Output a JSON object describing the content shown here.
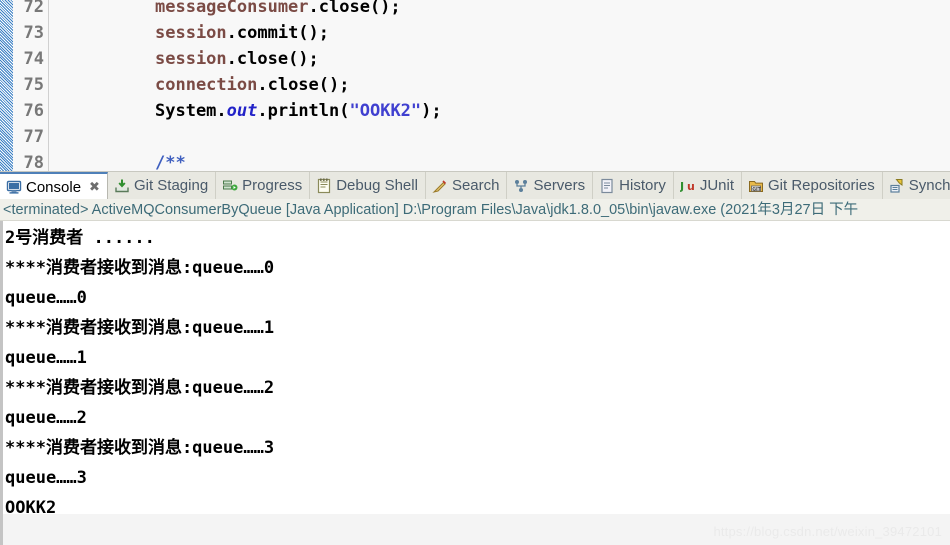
{
  "editor": {
    "lines": [
      {
        "num": "72",
        "segments": [
          {
            "text": "messageConsumer",
            "style": "var"
          },
          {
            "text": ".close();",
            "style": "plain"
          }
        ]
      },
      {
        "num": "73",
        "segments": [
          {
            "text": "session",
            "style": "var"
          },
          {
            "text": ".commit();",
            "style": "plain"
          }
        ]
      },
      {
        "num": "74",
        "segments": [
          {
            "text": "session",
            "style": "var"
          },
          {
            "text": ".close();",
            "style": "plain"
          }
        ]
      },
      {
        "num": "75",
        "segments": [
          {
            "text": "connection",
            "style": "var"
          },
          {
            "text": ".close();",
            "style": "plain"
          }
        ]
      },
      {
        "num": "76",
        "segments": [
          {
            "text": "System.",
            "style": "plain"
          },
          {
            "text": "out",
            "style": "field"
          },
          {
            "text": ".println(",
            "style": "plain"
          },
          {
            "text": "\"OOKK2\"",
            "style": "str"
          },
          {
            "text": ");",
            "style": "plain"
          }
        ]
      },
      {
        "num": "77",
        "segments": []
      },
      {
        "num": "78",
        "segments": [
          {
            "text": "/**",
            "style": "cmt"
          }
        ]
      }
    ]
  },
  "tabs": [
    {
      "label": "Console",
      "icon": "console-icon",
      "active": true,
      "close": "✖"
    },
    {
      "label": "Git Staging",
      "icon": "git-staging-icon",
      "active": false,
      "close": ""
    },
    {
      "label": "Progress",
      "icon": "progress-icon",
      "active": false,
      "close": ""
    },
    {
      "label": "Debug Shell",
      "icon": "debug-shell-icon",
      "active": false,
      "close": ""
    },
    {
      "label": "Search",
      "icon": "search-icon",
      "active": false,
      "close": ""
    },
    {
      "label": "Servers",
      "icon": "servers-icon",
      "active": false,
      "close": ""
    },
    {
      "label": "History",
      "icon": "history-icon",
      "active": false,
      "close": ""
    },
    {
      "label": "JUnit",
      "icon": "junit-icon",
      "active": false,
      "close": ""
    },
    {
      "label": "Git Repositories",
      "icon": "git-repositories-icon",
      "active": false,
      "close": ""
    },
    {
      "label": "Synchro",
      "icon": "synchronize-icon",
      "active": false,
      "close": ""
    }
  ],
  "launch": {
    "text": "<terminated> ActiveMQConsumerByQueue [Java Application] D:\\Program Files\\Java\\jdk1.8.0_05\\bin\\javaw.exe  (2021年3月27日 下午"
  },
  "console": {
    "output": [
      "2号消费者 ......",
      "****消费者接收到消息:queue……0",
      "queue……0",
      "****消费者接收到消息:queue……1",
      "queue……1",
      "****消费者接收到消息:queue……2",
      "queue……2",
      "****消费者接收到消息:queue……3",
      "queue……3",
      "OOKK2"
    ]
  },
  "watermark": {
    "text": "https://blog.csdn.net/weixin_39472101"
  },
  "colors": {
    "variable": "#7b4b45",
    "field": "#2323c8",
    "string": "#4040d0",
    "comment": "#3f5fbf",
    "tab_active_border": "#4f80b8",
    "launch_text": "#3d6b78"
  }
}
